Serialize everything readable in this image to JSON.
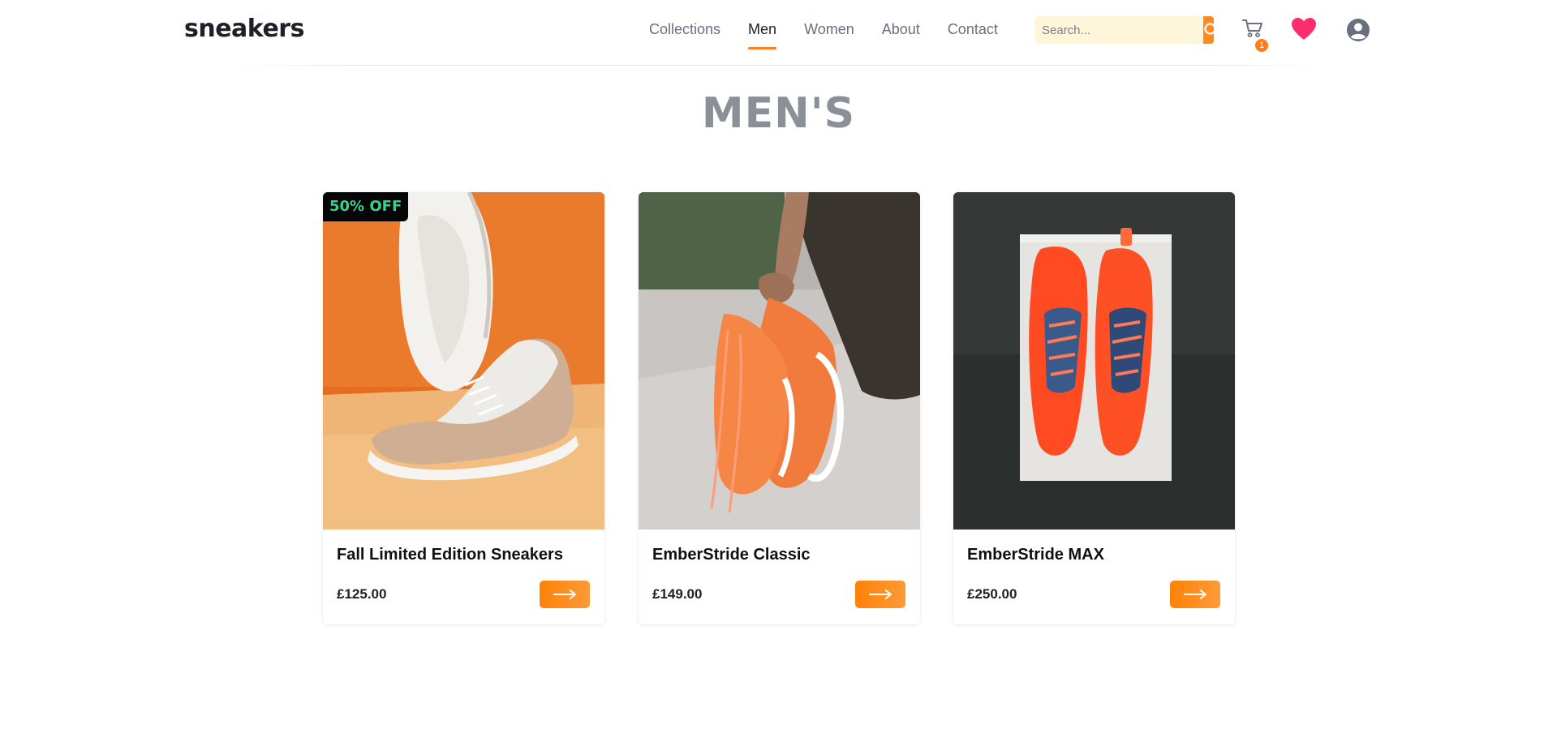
{
  "brand": {
    "logo_text": "sneakers"
  },
  "nav": {
    "items": [
      {
        "label": "Collections"
      },
      {
        "label": "Men"
      },
      {
        "label": "Women"
      },
      {
        "label": "About"
      },
      {
        "label": "Contact"
      }
    ],
    "active": "Men"
  },
  "search": {
    "placeholder": "Search..."
  },
  "cart": {
    "count": "1"
  },
  "icons": {
    "search": "search-icon",
    "cart": "cart-icon",
    "wishlist": "heart-icon",
    "account": "user-avatar-icon",
    "arrow": "arrow-right-icon"
  },
  "page": {
    "title": "MEN'S"
  },
  "products": [
    {
      "name": "Fall Limited Edition Sneakers",
      "price": "£125.00",
      "badge": "50% OFF"
    },
    {
      "name": "EmberStride Classic",
      "price": "£149.00"
    },
    {
      "name": "EmberStride MAX",
      "price": "£250.00"
    }
  ],
  "colors": {
    "accent": "#ff7e1b",
    "text_dark": "#1d2026",
    "text_muted": "#69707d",
    "title_gray": "#8a8f98",
    "badge_green": "#39d08a",
    "heart_pink": "#ff2d6f",
    "search_bg": "#fff6d9"
  }
}
